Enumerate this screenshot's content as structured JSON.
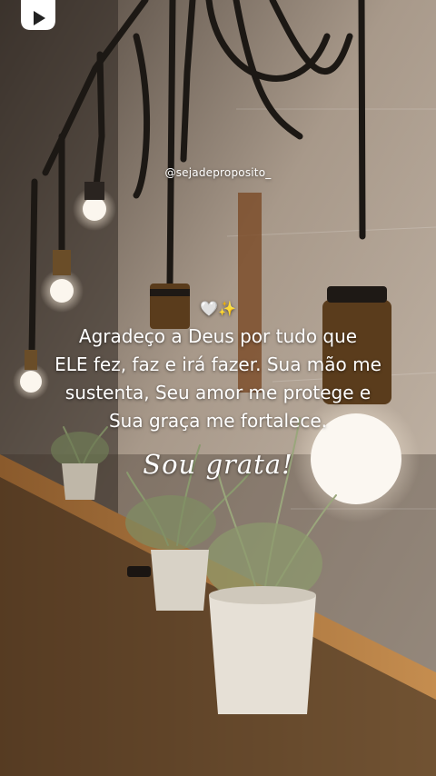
{
  "post": {
    "handle": "@sejadeproposito_",
    "emoji": "🤍✨",
    "quote_lines": [
      "Agradeço a Deus por tudo que",
      "ELE fez, faz e irá fazer. Sua mão me",
      "sustenta, Seu amor me protege e",
      "Sua graça me fortalece."
    ],
    "signature": "Sou grata!"
  },
  "icons": {
    "top_left": "play-logo-icon"
  },
  "colors": {
    "text": "#ffffff",
    "wall": "#b9aa98",
    "shelf": "#b0793e"
  }
}
